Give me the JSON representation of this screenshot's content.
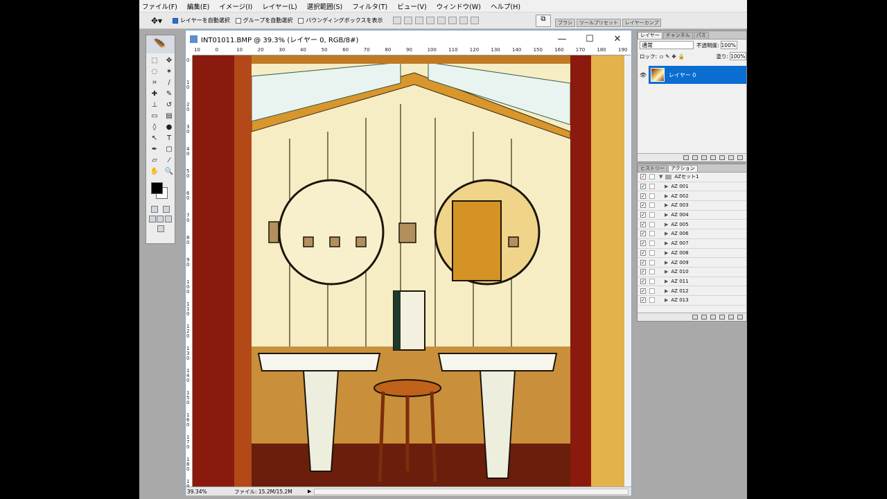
{
  "menu": [
    "ファイル(F)",
    "編集(E)",
    "イメージ(I)",
    "レイヤー(L)",
    "選択範囲(S)",
    "フィルタ(T)",
    "ビュー(V)",
    "ウィンドウ(W)",
    "ヘルプ(H)"
  ],
  "options": {
    "auto_select_layer": "レイヤーを自動選択",
    "auto_select_group": "グループを自動選択",
    "show_bounding_box": "バウンディングボックスを表示"
  },
  "palette_well_tabs": [
    "ブラシ",
    "ツールプリセット",
    "レイヤーカンプ"
  ],
  "document": {
    "title": "INT01011.BMP @ 39.3% (レイヤー 0, RGB/8#)",
    "status_zoom": "39.34%",
    "status_file": "ファイル: 15.2M/15.2M",
    "ruler_h": [
      "10",
      "0",
      "10",
      "20",
      "30",
      "40",
      "50",
      "60",
      "70",
      "80",
      "90",
      "100",
      "110",
      "120",
      "130",
      "140",
      "150",
      "160",
      "170",
      "180",
      "190"
    ],
    "ruler_v": [
      "0",
      "10",
      "20",
      "30",
      "40",
      "50",
      "60",
      "70",
      "80",
      "90",
      "100",
      "110",
      "120",
      "130",
      "140",
      "150",
      "160",
      "170",
      "180",
      "190"
    ]
  },
  "layers_panel": {
    "tabs": [
      "レイヤー",
      "チャンネル",
      "パス"
    ],
    "blend_mode": "通常",
    "opacity_label": "不透明度:",
    "opacity_value": "100%",
    "lock_label": "ロック:",
    "fill_label": "塗り:",
    "fill_value": "100%",
    "layer_name": "レイヤー 0"
  },
  "actions_panel": {
    "tabs": [
      "ヒストリー",
      "アクション"
    ],
    "set_name": "AZセット1",
    "actions": [
      "AZ 001",
      "AZ 002",
      "AZ 003",
      "AZ 004",
      "AZ 005",
      "AZ 006",
      "AZ 007",
      "AZ 008",
      "AZ 009",
      "AZ 010",
      "AZ 011",
      "AZ 012",
      "AZ 013"
    ]
  },
  "colors": {
    "accent": "#0a6ed1",
    "foreground_color": "#000000",
    "background_color": "#ffffff"
  }
}
